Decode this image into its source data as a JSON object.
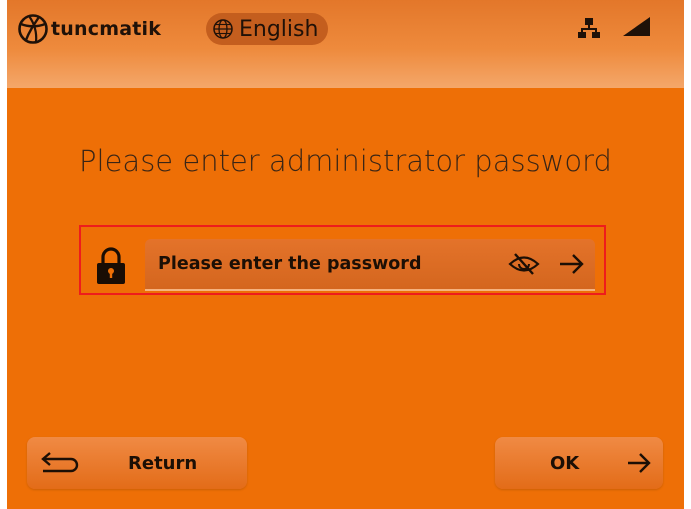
{
  "header": {
    "brand": "tuncmatik",
    "language": {
      "label": "English",
      "icon": "globe-icon"
    },
    "status_icons": [
      "network-icon",
      "signal-icon"
    ]
  },
  "main": {
    "prompt": "Please enter administrator password",
    "password": {
      "placeholder": "Please enter the password",
      "value": "",
      "icons": [
        "lock-icon",
        "eye-off-icon",
        "arrow-right-icon"
      ]
    }
  },
  "footer": {
    "return_label": "Return",
    "ok_label": "OK"
  },
  "colors": {
    "background": "#ee6f06",
    "highlight_frame": "#ee1c1c",
    "text": "#1c0f05"
  }
}
